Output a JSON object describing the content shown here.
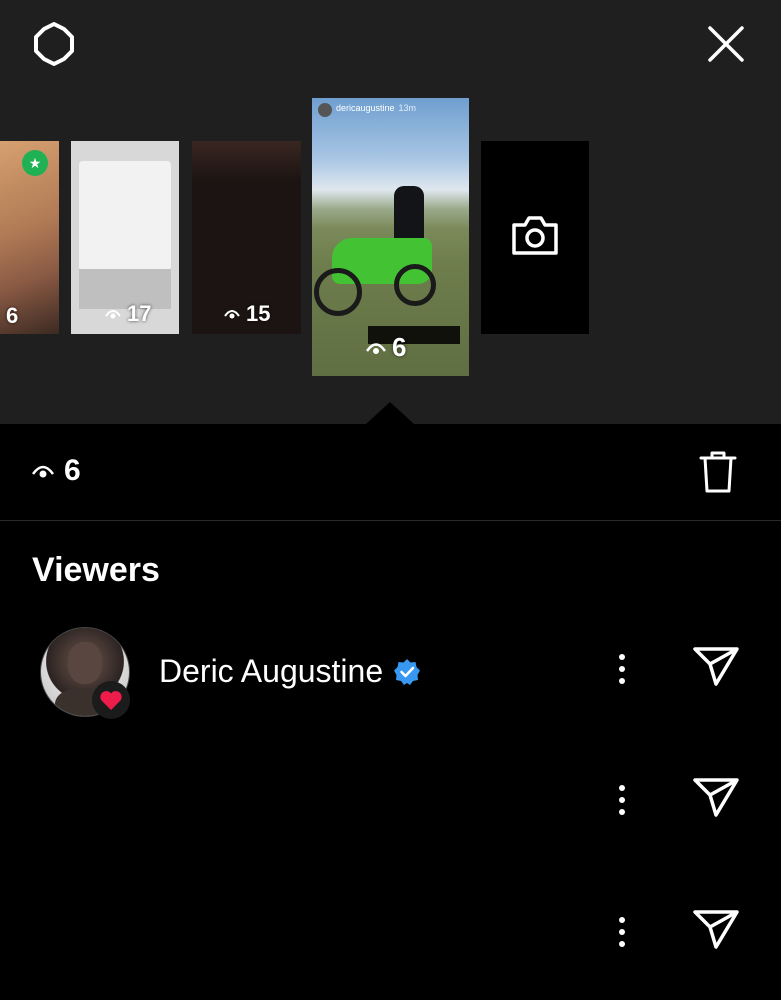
{
  "header": {
    "settings_icon": "settings-gear-icon",
    "close_icon": "close-icon"
  },
  "stories": [
    {
      "views": "6",
      "badge": "star"
    },
    {
      "views": "17"
    },
    {
      "views": "15"
    },
    {
      "author": "dericaugustine",
      "time": "13m",
      "views": "6",
      "selected": true
    },
    {
      "type": "add-story",
      "icon": "camera-icon"
    }
  ],
  "stats": {
    "views": "6",
    "delete_icon": "trash-icon"
  },
  "viewers": {
    "title": "Viewers",
    "list": [
      {
        "name": "Deric Augustine",
        "verified": true,
        "liked": true
      },
      {
        "name": ""
      },
      {
        "name": ""
      }
    ]
  },
  "colors": {
    "verified": "#3897f0",
    "heart": "#ed1c4b",
    "star_badge": "#1fb153",
    "top_bg": "#1f1f1f"
  }
}
